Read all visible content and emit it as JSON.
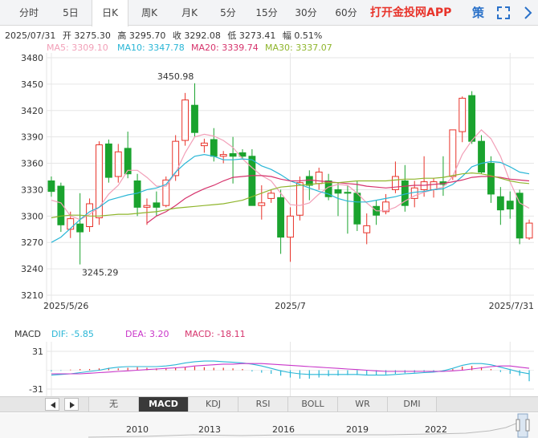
{
  "tabs": [
    {
      "label": "分时",
      "active": false
    },
    {
      "label": "5日",
      "active": false
    },
    {
      "label": "日K",
      "active": true
    },
    {
      "label": "周K",
      "active": false
    },
    {
      "label": "月K",
      "active": false
    },
    {
      "label": "5分",
      "active": false
    },
    {
      "label": "15分",
      "active": false
    },
    {
      "label": "30分",
      "active": false
    },
    {
      "label": "60分",
      "active": false
    }
  ],
  "app_link": "打开金投网APP",
  "policy_btn": "策",
  "quote": {
    "date": "2025/07/31",
    "open_label": "开",
    "open": "3275.30",
    "high_label": "高",
    "high": "3295.70",
    "close_label": "收",
    "close": "3292.08",
    "low_label": "低",
    "low": "3273.41",
    "amp_label": "幅",
    "amp": "0.51%"
  },
  "ma_legend": [
    {
      "label": "MA5:",
      "value": "3309.10",
      "color": "#f2a0b8"
    },
    {
      "label": "MA10:",
      "value": "3347.78",
      "color": "#29b6d6"
    },
    {
      "label": "MA20:",
      "value": "3339.74",
      "color": "#d6336c"
    },
    {
      "label": "MA30:",
      "value": "3337.07",
      "color": "#8fb52c"
    }
  ],
  "macd_legend": {
    "title": "MACD",
    "dif_label": "DIF:",
    "dif": "-5.85",
    "dif_color": "#29b6d6",
    "dea_label": "DEA:",
    "dea": "3.20",
    "dea_color": "#c936c9",
    "macd_label": "MACD:",
    "macd": "-18.11",
    "macd_color": "#d6336c",
    "top_tick": "31",
    "bottom_tick": "-31"
  },
  "indicators": [
    {
      "label": "无",
      "active": false
    },
    {
      "label": "MACD",
      "active": true
    },
    {
      "label": "KDJ",
      "active": false
    },
    {
      "label": "RSI",
      "active": false
    },
    {
      "label": "BOLL",
      "active": false
    },
    {
      "label": "WR",
      "active": false
    },
    {
      "label": "DMI",
      "active": false
    }
  ],
  "overview_years": [
    "2010",
    "2013",
    "2016",
    "2019",
    "2022"
  ],
  "colors": {
    "up": "#e8332a",
    "down": "#1aa32e",
    "grid": "#e6e6e6"
  },
  "chart_data": {
    "type": "candlestick",
    "y_ticks": [
      3480,
      3450,
      3420,
      3390,
      3360,
      3330,
      3300,
      3270,
      3240,
      3210
    ],
    "ylim": [
      3210,
      3480
    ],
    "x_labels": [
      {
        "index": 0,
        "label": "2025/5/26"
      },
      {
        "index": 25,
        "label": "2025/7"
      },
      {
        "index": 48,
        "label": "2025/7/31"
      }
    ],
    "max_annotation": {
      "index": 14,
      "label": "3450.98",
      "value": 3450.98
    },
    "min_annotation": {
      "index": 3,
      "label": "3245.29",
      "value": 3245.29
    },
    "candles": [
      {
        "o": 3340,
        "h": 3345,
        "l": 3322,
        "c": 3328
      },
      {
        "o": 3334,
        "h": 3338,
        "l": 3282,
        "c": 3290
      },
      {
        "o": 3285,
        "h": 3305,
        "l": 3275,
        "c": 3297
      },
      {
        "o": 3291,
        "h": 3326,
        "l": 3245,
        "c": 3282
      },
      {
        "o": 3288,
        "h": 3320,
        "l": 3282,
        "c": 3314
      },
      {
        "o": 3298,
        "h": 3385,
        "l": 3290,
        "c": 3381
      },
      {
        "o": 3382,
        "h": 3387,
        "l": 3338,
        "c": 3344
      },
      {
        "o": 3345,
        "h": 3382,
        "l": 3338,
        "c": 3373
      },
      {
        "o": 3377,
        "h": 3396,
        "l": 3343,
        "c": 3348
      },
      {
        "o": 3340,
        "h": 3348,
        "l": 3300,
        "c": 3310
      },
      {
        "o": 3310,
        "h": 3320,
        "l": 3290,
        "c": 3312
      },
      {
        "o": 3315,
        "h": 3328,
        "l": 3300,
        "c": 3310
      },
      {
        "o": 3312,
        "h": 3345,
        "l": 3310,
        "c": 3341
      },
      {
        "o": 3346,
        "h": 3392,
        "l": 3340,
        "c": 3385
      },
      {
        "o": 3386,
        "h": 3440,
        "l": 3380,
        "c": 3432
      },
      {
        "o": 3426,
        "h": 3451,
        "l": 3390,
        "c": 3395
      },
      {
        "o": 3380,
        "h": 3388,
        "l": 3372,
        "c": 3383
      },
      {
        "o": 3387,
        "h": 3400,
        "l": 3362,
        "c": 3368
      },
      {
        "o": 3368,
        "h": 3374,
        "l": 3360,
        "c": 3370
      },
      {
        "o": 3371,
        "h": 3390,
        "l": 3337,
        "c": 3368
      },
      {
        "o": 3372,
        "h": 3376,
        "l": 3365,
        "c": 3368
      },
      {
        "o": 3368,
        "h": 3376,
        "l": 3340,
        "c": 3312
      },
      {
        "o": 3312,
        "h": 3335,
        "l": 3296,
        "c": 3315
      },
      {
        "o": 3320,
        "h": 3330,
        "l": 3315,
        "c": 3326
      },
      {
        "o": 3321,
        "h": 3330,
        "l": 3257,
        "c": 3276
      },
      {
        "o": 3276,
        "h": 3310,
        "l": 3248,
        "c": 3300
      },
      {
        "o": 3301,
        "h": 3345,
        "l": 3295,
        "c": 3338
      },
      {
        "o": 3345,
        "h": 3352,
        "l": 3318,
        "c": 3335
      },
      {
        "o": 3337,
        "h": 3355,
        "l": 3330,
        "c": 3350
      },
      {
        "o": 3340,
        "h": 3348,
        "l": 3318,
        "c": 3322
      },
      {
        "o": 3330,
        "h": 3338,
        "l": 3300,
        "c": 3326
      },
      {
        "o": 3327,
        "h": 3335,
        "l": 3280,
        "c": 3326
      },
      {
        "o": 3326,
        "h": 3340,
        "l": 3283,
        "c": 3291
      },
      {
        "o": 3281,
        "h": 3303,
        "l": 3268,
        "c": 3289
      },
      {
        "o": 3311,
        "h": 3318,
        "l": 3290,
        "c": 3301
      },
      {
        "o": 3305,
        "h": 3325,
        "l": 3302,
        "c": 3316
      },
      {
        "o": 3330,
        "h": 3362,
        "l": 3326,
        "c": 3345
      },
      {
        "o": 3340,
        "h": 3358,
        "l": 3305,
        "c": 3312
      },
      {
        "o": 3320,
        "h": 3340,
        "l": 3310,
        "c": 3332
      },
      {
        "o": 3330,
        "h": 3368,
        "l": 3322,
        "c": 3339
      },
      {
        "o": 3330,
        "h": 3343,
        "l": 3321,
        "c": 3339
      },
      {
        "o": 3339,
        "h": 3368,
        "l": 3323,
        "c": 3336
      },
      {
        "o": 3345,
        "h": 3398,
        "l": 3341,
        "c": 3398
      },
      {
        "o": 3396,
        "h": 3436,
        "l": 3384,
        "c": 3434
      },
      {
        "o": 3437,
        "h": 3442,
        "l": 3382,
        "c": 3385
      },
      {
        "o": 3385,
        "h": 3392,
        "l": 3348,
        "c": 3350
      },
      {
        "o": 3360,
        "h": 3368,
        "l": 3315,
        "c": 3325
      },
      {
        "o": 3322,
        "h": 3333,
        "l": 3290,
        "c": 3307
      },
      {
        "o": 3317,
        "h": 3328,
        "l": 3297,
        "c": 3308
      },
      {
        "o": 3326,
        "h": 3330,
        "l": 3268,
        "c": 3275
      },
      {
        "o": 3275,
        "h": 3296,
        "l": 3273,
        "c": 3292
      }
    ],
    "ma_series": [
      {
        "name": "MA5",
        "color": "#f2a0b8",
        "values": [
          3318,
          3315,
          3300,
          3296,
          3302,
          3310,
          3325,
          3335,
          3352,
          3352,
          3344,
          3334,
          3334,
          3349,
          3372,
          3390,
          3393,
          3391,
          3386,
          3378,
          3365,
          3355,
          3346,
          3340,
          3326,
          3313,
          3312,
          3315,
          3325,
          3333,
          3336,
          3335,
          3326,
          3315,
          3306,
          3306,
          3310,
          3317,
          3323,
          3327,
          3330,
          3333,
          3345,
          3370,
          3386,
          3398,
          3388,
          3368,
          3339,
          3315,
          3309
        ]
      },
      {
        "name": "MA10",
        "color": "#29b6d6",
        "values": [
          3270,
          3276,
          3286,
          3296,
          3305,
          3310,
          3318,
          3321,
          3324,
          3326,
          3330,
          3332,
          3336,
          3350,
          3360,
          3368,
          3370,
          3368,
          3364,
          3364,
          3365,
          3364,
          3357,
          3353,
          3347,
          3340,
          3336,
          3332,
          3328,
          3325,
          3320,
          3317,
          3316,
          3316,
          3318,
          3320,
          3322,
          3325,
          3327,
          3328,
          3330,
          3331,
          3336,
          3345,
          3356,
          3360,
          3362,
          3361,
          3356,
          3350,
          3348
        ]
      },
      {
        "name": "MA20",
        "color": "#d6336c",
        "values": [
          null,
          null,
          null,
          null,
          null,
          null,
          null,
          null,
          null,
          null,
          3292,
          3300,
          3305,
          3312,
          3320,
          3326,
          3331,
          3335,
          3340,
          3344,
          3345,
          3346,
          3346,
          3345,
          3342,
          3340,
          3340,
          3341,
          3340,
          3339,
          3338,
          3337,
          3336,
          3334,
          3333,
          3332,
          3333,
          3334,
          3335,
          3335,
          3336,
          3337,
          3339,
          3341,
          3344,
          3345,
          3345,
          3344,
          3342,
          3341,
          3340
        ]
      },
      {
        "name": "MA30",
        "color": "#8fb52c",
        "values": [
          3298,
          3300,
          3301,
          3301,
          3300,
          3300,
          3301,
          3302,
          3302,
          3303,
          3304,
          3305,
          3307,
          3309,
          3310,
          3311,
          3312,
          3313,
          3314,
          3316,
          3318,
          3322,
          3326,
          3330,
          3333,
          3334,
          3335,
          3336,
          3337,
          3338,
          3338,
          3339,
          3340,
          3340,
          3340,
          3340,
          3341,
          3342,
          3342,
          3343,
          3343,
          3344,
          3346,
          3348,
          3349,
          3348,
          3346,
          3343,
          3340,
          3338,
          3337
        ]
      }
    ],
    "macd_hist": [
      -2,
      -1,
      1,
      2,
      2,
      3,
      4,
      3,
      4,
      5,
      4,
      3,
      3,
      4,
      5,
      6,
      5,
      4,
      4,
      3,
      2,
      -2,
      -4,
      -6,
      -9,
      -12,
      -14,
      -14,
      -12,
      -10,
      -9,
      -8,
      -8,
      -8,
      -8,
      -7,
      -6,
      -5,
      -4,
      -3,
      -2,
      -1,
      2,
      6,
      7,
      5,
      2,
      -3,
      -6,
      -9,
      -18.11
    ],
    "dif": [
      -8,
      -7,
      -6,
      -4,
      -2,
      0,
      3,
      5,
      6,
      6,
      6,
      6,
      7,
      9,
      12,
      14,
      15,
      15,
      14,
      13,
      12,
      10,
      7,
      3,
      -1,
      -4,
      -6,
      -7,
      -7,
      -7,
      -7,
      -7,
      -7,
      -8,
      -8,
      -8,
      -7,
      -6,
      -5,
      -4,
      -3,
      -1,
      3,
      8,
      11,
      11,
      9,
      5,
      1,
      -3,
      -5.85
    ],
    "dea": [
      -6,
      -6,
      -6,
      -6,
      -5,
      -4,
      -3,
      -2,
      -1,
      0,
      1,
      2,
      3,
      4,
      5,
      7,
      8,
      9,
      10,
      10,
      11,
      11,
      11,
      10,
      9,
      8,
      7,
      6,
      5,
      4,
      3,
      2,
      1,
      0,
      -1,
      -2,
      -2,
      -2,
      -2,
      -2,
      -2,
      -2,
      -1,
      0,
      2,
      4,
      6,
      7,
      7,
      5,
      3.2
    ],
    "macd_range": [
      -31,
      31
    ]
  }
}
